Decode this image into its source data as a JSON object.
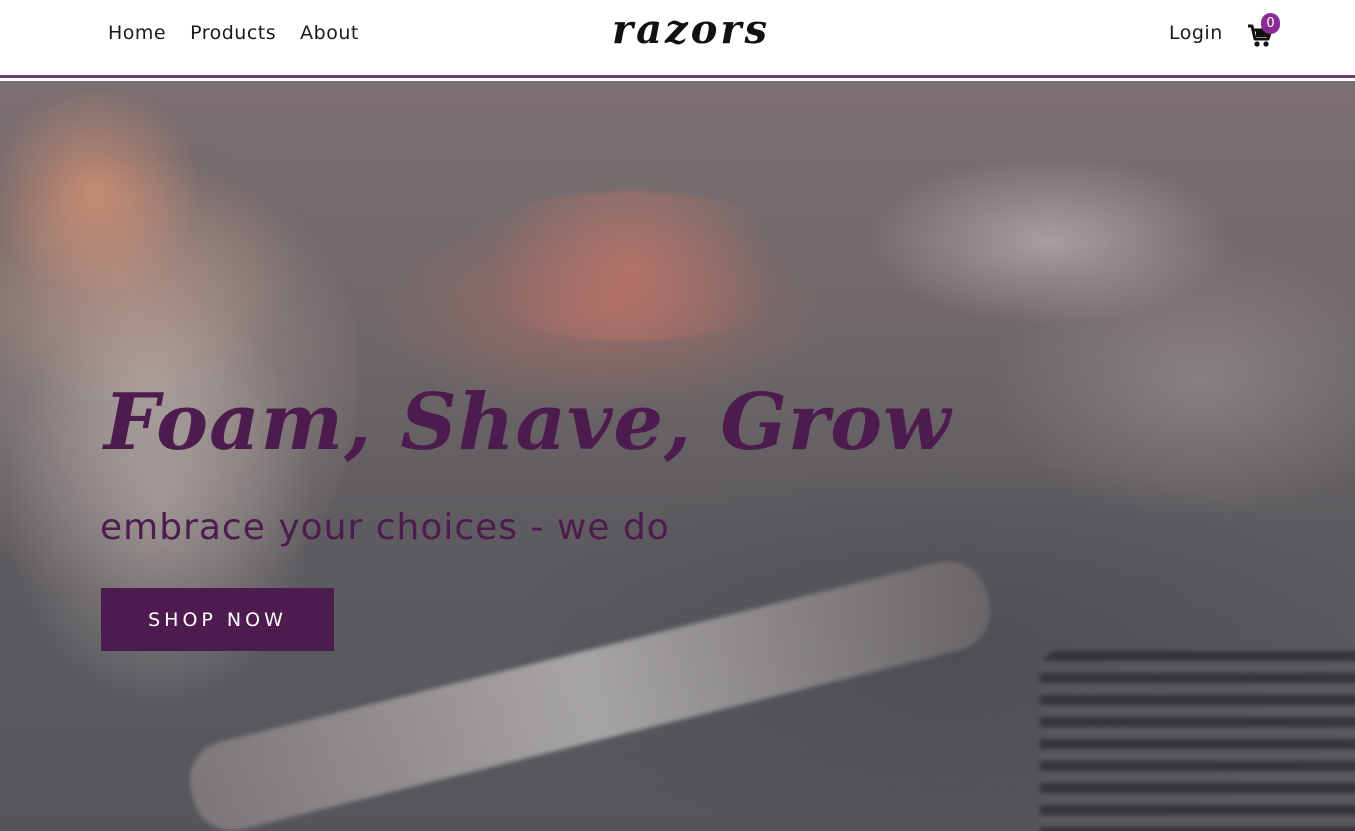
{
  "nav": {
    "links": [
      {
        "label": "Home"
      },
      {
        "label": "Products"
      },
      {
        "label": "About"
      }
    ],
    "brand": "razors",
    "login_label": "Login",
    "cart_count": "0"
  },
  "hero": {
    "title": "Foam, Shave, Grow",
    "subtitle": "embrace your choices - we do",
    "cta_label": "SHOP NOW"
  },
  "colors": {
    "accent": "#4e1b4f",
    "badge": "#8a2d92",
    "nav_border": "#6b3f73"
  },
  "icons": {
    "cart": "shopping-cart-icon"
  }
}
